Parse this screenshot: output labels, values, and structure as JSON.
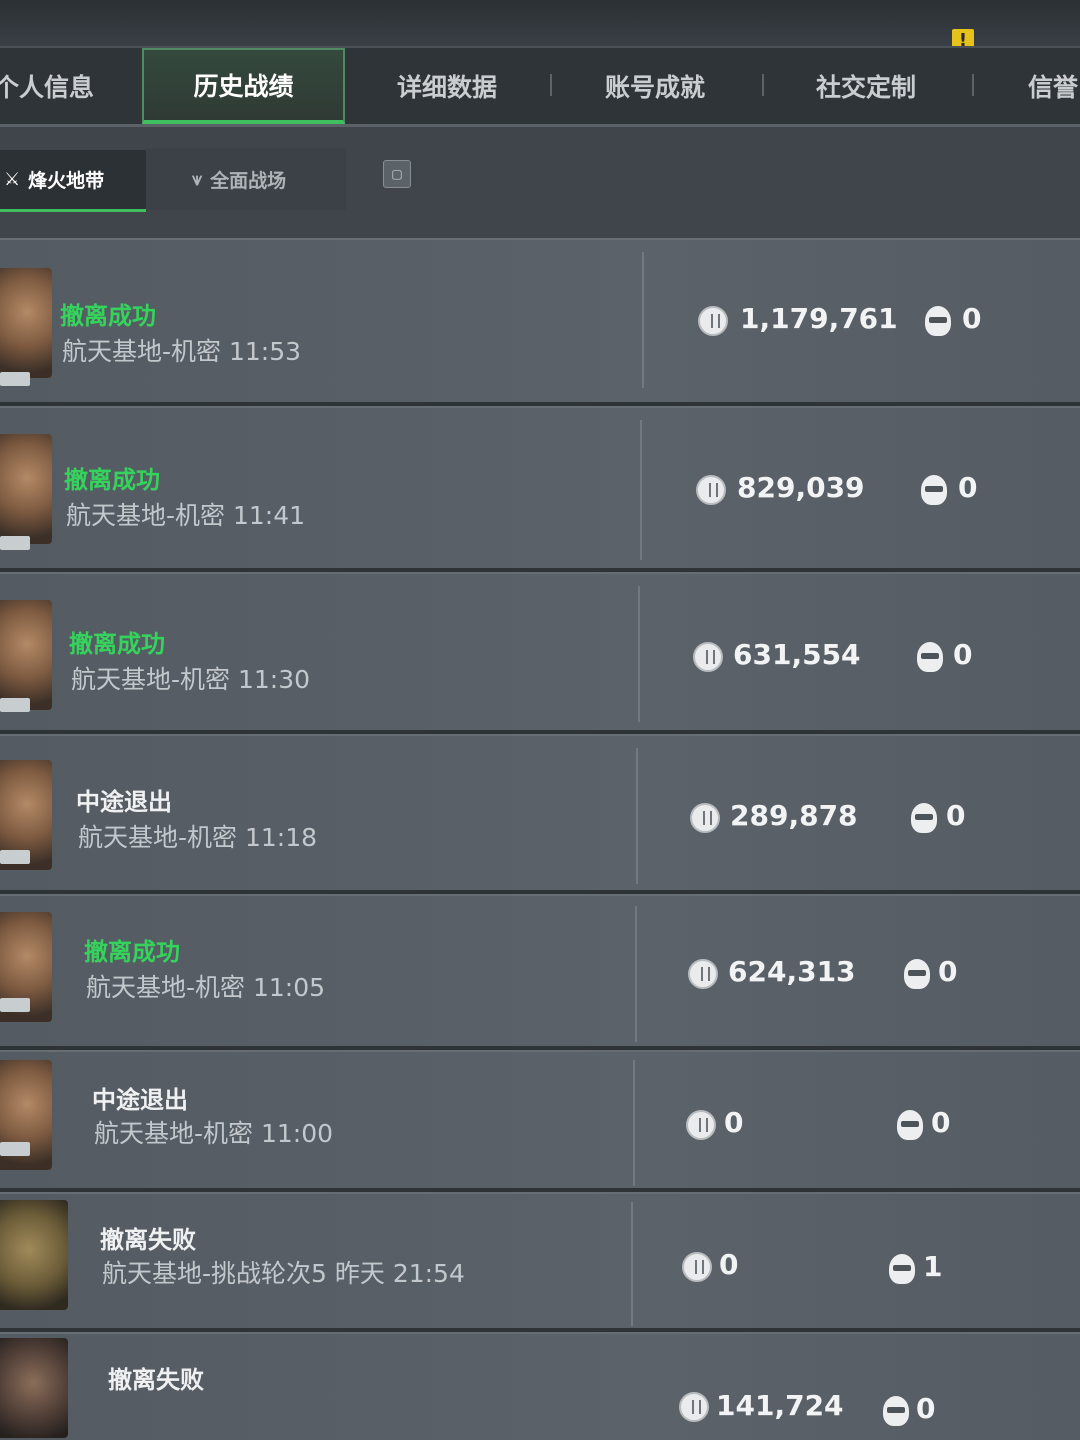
{
  "tabs": [
    {
      "label": "个人信息",
      "active": false
    },
    {
      "label": "历史战绩",
      "active": true
    },
    {
      "label": "详细数据",
      "active": false
    },
    {
      "label": "账号成就",
      "active": false
    },
    {
      "label": "社交定制",
      "active": false
    },
    {
      "label": "信誉",
      "active": false
    }
  ],
  "warning_badge": "!",
  "subtabs": [
    {
      "label": "烽火地带",
      "active": true,
      "icon": "zone-icon"
    },
    {
      "label": "全面战场",
      "active": false,
      "icon": "battlefield-icon"
    }
  ],
  "records": [
    {
      "status": "撤离成功",
      "status_color": "#35d35c",
      "detail": "航天基地-机密 11:53",
      "coins": "1,179,761",
      "kills": "0"
    },
    {
      "status": "撤离成功",
      "status_color": "#35d35c",
      "detail": "航天基地-机密 11:41",
      "coins": "829,039",
      "kills": "0"
    },
    {
      "status": "撤离成功",
      "status_color": "#35d35c",
      "detail": "航天基地-机密 11:30",
      "coins": "631,554",
      "kills": "0"
    },
    {
      "status": "中途退出",
      "status_color": "#eef0f2",
      "detail": "航天基地-机密 11:18",
      "coins": "289,878",
      "kills": "0"
    },
    {
      "status": "撤离成功",
      "status_color": "#35d35c",
      "detail": "航天基地-机密 11:05",
      "coins": "624,313",
      "kills": "0"
    },
    {
      "status": "中途退出",
      "status_color": "#eef0f2",
      "detail": "航天基地-机密 11:00",
      "coins": "0",
      "kills": "0"
    },
    {
      "status": "撤离失败",
      "status_color": "#eef0f2",
      "detail": "航天基地-挑战轮次5 昨天 21:54",
      "coins": "0",
      "kills": "1"
    },
    {
      "status": "撤离失败",
      "status_color": "#eef0f2",
      "detail": "",
      "coins": "141,724",
      "kills": "0"
    }
  ]
}
